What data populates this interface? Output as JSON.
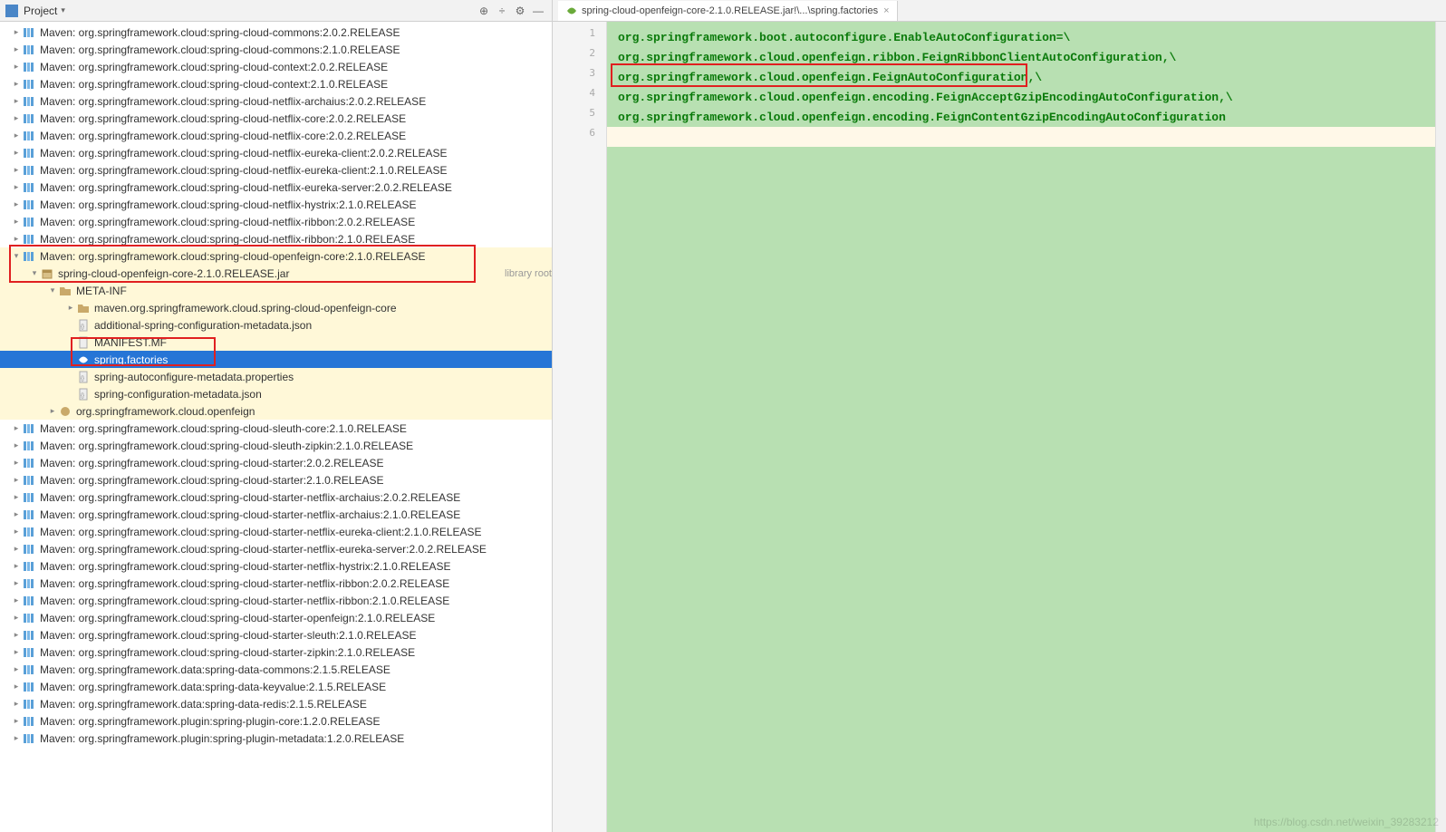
{
  "projectPanel": {
    "title": "Project"
  },
  "tree": [
    {
      "indent": 0,
      "arrow": "collapsed",
      "icon": "lib",
      "label": "Maven: org.springframework.cloud:spring-cloud-commons:2.0.2.RELEASE"
    },
    {
      "indent": 0,
      "arrow": "collapsed",
      "icon": "lib",
      "label": "Maven: org.springframework.cloud:spring-cloud-commons:2.1.0.RELEASE"
    },
    {
      "indent": 0,
      "arrow": "collapsed",
      "icon": "lib",
      "label": "Maven: org.springframework.cloud:spring-cloud-context:2.0.2.RELEASE"
    },
    {
      "indent": 0,
      "arrow": "collapsed",
      "icon": "lib",
      "label": "Maven: org.springframework.cloud:spring-cloud-context:2.1.0.RELEASE"
    },
    {
      "indent": 0,
      "arrow": "collapsed",
      "icon": "lib",
      "label": "Maven: org.springframework.cloud:spring-cloud-netflix-archaius:2.0.2.RELEASE"
    },
    {
      "indent": 0,
      "arrow": "collapsed",
      "icon": "lib",
      "label": "Maven: org.springframework.cloud:spring-cloud-netflix-core:2.0.2.RELEASE"
    },
    {
      "indent": 0,
      "arrow": "collapsed",
      "icon": "lib",
      "label": "Maven: org.springframework.cloud:spring-cloud-netflix-core:2.0.2.RELEASE"
    },
    {
      "indent": 0,
      "arrow": "collapsed",
      "icon": "lib",
      "label": "Maven: org.springframework.cloud:spring-cloud-netflix-eureka-client:2.0.2.RELEASE"
    },
    {
      "indent": 0,
      "arrow": "collapsed",
      "icon": "lib",
      "label": "Maven: org.springframework.cloud:spring-cloud-netflix-eureka-client:2.1.0.RELEASE"
    },
    {
      "indent": 0,
      "arrow": "collapsed",
      "icon": "lib",
      "label": "Maven: org.springframework.cloud:spring-cloud-netflix-eureka-server:2.0.2.RELEASE"
    },
    {
      "indent": 0,
      "arrow": "collapsed",
      "icon": "lib",
      "label": "Maven: org.springframework.cloud:spring-cloud-netflix-hystrix:2.1.0.RELEASE"
    },
    {
      "indent": 0,
      "arrow": "collapsed",
      "icon": "lib",
      "label": "Maven: org.springframework.cloud:spring-cloud-netflix-ribbon:2.0.2.RELEASE"
    },
    {
      "indent": 0,
      "arrow": "collapsed",
      "icon": "lib",
      "label": "Maven: org.springframework.cloud:spring-cloud-netflix-ribbon:2.1.0.RELEASE"
    },
    {
      "indent": 0,
      "arrow": "expanded",
      "icon": "lib",
      "label": "Maven: org.springframework.cloud:spring-cloud-openfeign-core:2.1.0.RELEASE",
      "redbox": true,
      "hl": "yellow"
    },
    {
      "indent": 1,
      "arrow": "expanded",
      "icon": "jar",
      "label": "spring-cloud-openfeign-core-2.1.0.RELEASE.jar",
      "suffix": "library root",
      "hl": "yellow"
    },
    {
      "indent": 2,
      "arrow": "expanded",
      "icon": "folder",
      "label": "META-INF",
      "hl": "yellow"
    },
    {
      "indent": 3,
      "arrow": "collapsed",
      "icon": "folder",
      "label": "maven.org.springframework.cloud.spring-cloud-openfeign-core",
      "hl": "yellow"
    },
    {
      "indent": 3,
      "arrow": "none",
      "icon": "json",
      "label": "additional-spring-configuration-metadata.json",
      "hl": "yellow"
    },
    {
      "indent": 3,
      "arrow": "none",
      "icon": "file",
      "label": "MANIFEST.MF",
      "hl": "yellow",
      "redpartial": true
    },
    {
      "indent": 3,
      "arrow": "none",
      "icon": "leaf",
      "label": "spring.factories",
      "selected": true,
      "redbox2": true
    },
    {
      "indent": 3,
      "arrow": "none",
      "icon": "json",
      "label": "spring-autoconfigure-metadata.properties",
      "hl": "yellow"
    },
    {
      "indent": 3,
      "arrow": "none",
      "icon": "json",
      "label": "spring-configuration-metadata.json",
      "hl": "yellow"
    },
    {
      "indent": 2,
      "arrow": "collapsed",
      "icon": "pkg",
      "label": "org.springframework.cloud.openfeign",
      "hl": "yellow"
    },
    {
      "indent": 0,
      "arrow": "collapsed",
      "icon": "lib",
      "label": "Maven: org.springframework.cloud:spring-cloud-sleuth-core:2.1.0.RELEASE"
    },
    {
      "indent": 0,
      "arrow": "collapsed",
      "icon": "lib",
      "label": "Maven: org.springframework.cloud:spring-cloud-sleuth-zipkin:2.1.0.RELEASE"
    },
    {
      "indent": 0,
      "arrow": "collapsed",
      "icon": "lib",
      "label": "Maven: org.springframework.cloud:spring-cloud-starter:2.0.2.RELEASE"
    },
    {
      "indent": 0,
      "arrow": "collapsed",
      "icon": "lib",
      "label": "Maven: org.springframework.cloud:spring-cloud-starter:2.1.0.RELEASE"
    },
    {
      "indent": 0,
      "arrow": "collapsed",
      "icon": "lib",
      "label": "Maven: org.springframework.cloud:spring-cloud-starter-netflix-archaius:2.0.2.RELEASE"
    },
    {
      "indent": 0,
      "arrow": "collapsed",
      "icon": "lib",
      "label": "Maven: org.springframework.cloud:spring-cloud-starter-netflix-archaius:2.1.0.RELEASE"
    },
    {
      "indent": 0,
      "arrow": "collapsed",
      "icon": "lib",
      "label": "Maven: org.springframework.cloud:spring-cloud-starter-netflix-eureka-client:2.1.0.RELEASE"
    },
    {
      "indent": 0,
      "arrow": "collapsed",
      "icon": "lib",
      "label": "Maven: org.springframework.cloud:spring-cloud-starter-netflix-eureka-server:2.0.2.RELEASE"
    },
    {
      "indent": 0,
      "arrow": "collapsed",
      "icon": "lib",
      "label": "Maven: org.springframework.cloud:spring-cloud-starter-netflix-hystrix:2.1.0.RELEASE"
    },
    {
      "indent": 0,
      "arrow": "collapsed",
      "icon": "lib",
      "label": "Maven: org.springframework.cloud:spring-cloud-starter-netflix-ribbon:2.0.2.RELEASE"
    },
    {
      "indent": 0,
      "arrow": "collapsed",
      "icon": "lib",
      "label": "Maven: org.springframework.cloud:spring-cloud-starter-netflix-ribbon:2.1.0.RELEASE"
    },
    {
      "indent": 0,
      "arrow": "collapsed",
      "icon": "lib",
      "label": "Maven: org.springframework.cloud:spring-cloud-starter-openfeign:2.1.0.RELEASE"
    },
    {
      "indent": 0,
      "arrow": "collapsed",
      "icon": "lib",
      "label": "Maven: org.springframework.cloud:spring-cloud-starter-sleuth:2.1.0.RELEASE"
    },
    {
      "indent": 0,
      "arrow": "collapsed",
      "icon": "lib",
      "label": "Maven: org.springframework.cloud:spring-cloud-starter-zipkin:2.1.0.RELEASE"
    },
    {
      "indent": 0,
      "arrow": "collapsed",
      "icon": "lib",
      "label": "Maven: org.springframework.data:spring-data-commons:2.1.5.RELEASE"
    },
    {
      "indent": 0,
      "arrow": "collapsed",
      "icon": "lib",
      "label": "Maven: org.springframework.data:spring-data-keyvalue:2.1.5.RELEASE"
    },
    {
      "indent": 0,
      "arrow": "collapsed",
      "icon": "lib",
      "label": "Maven: org.springframework.data:spring-data-redis:2.1.5.RELEASE"
    },
    {
      "indent": 0,
      "arrow": "collapsed",
      "icon": "lib",
      "label": "Maven: org.springframework.plugin:spring-plugin-core:1.2.0.RELEASE"
    },
    {
      "indent": 0,
      "arrow": "collapsed",
      "icon": "lib",
      "label": "Maven: org.springframework.plugin:spring-plugin-metadata:1.2.0.RELEASE"
    }
  ],
  "editor": {
    "tabLabel": "spring-cloud-openfeign-core-2.1.0.RELEASE.jar!\\...\\spring.factories",
    "lines": [
      {
        "n": "1",
        "text": "org.springframework.boot.autoconfigure.EnableAutoConfiguration=\\"
      },
      {
        "n": "2",
        "text": "org.springframework.cloud.openfeign.ribbon.FeignRibbonClientAutoConfiguration,\\"
      },
      {
        "n": "3",
        "text": "org.springframework.cloud.openfeign.FeignAutoConfiguration,\\",
        "boxed": true
      },
      {
        "n": "4",
        "text": "org.springframework.cloud.openfeign.encoding.FeignAcceptGzipEncodingAutoConfiguration,\\"
      },
      {
        "n": "5",
        "text": "org.springframework.cloud.openfeign.encoding.FeignContentGzipEncodingAutoConfiguration"
      },
      {
        "n": "6",
        "text": "",
        "blank": true
      }
    ]
  },
  "watermark": "https://blog.csdn.net/weixin_39283212"
}
